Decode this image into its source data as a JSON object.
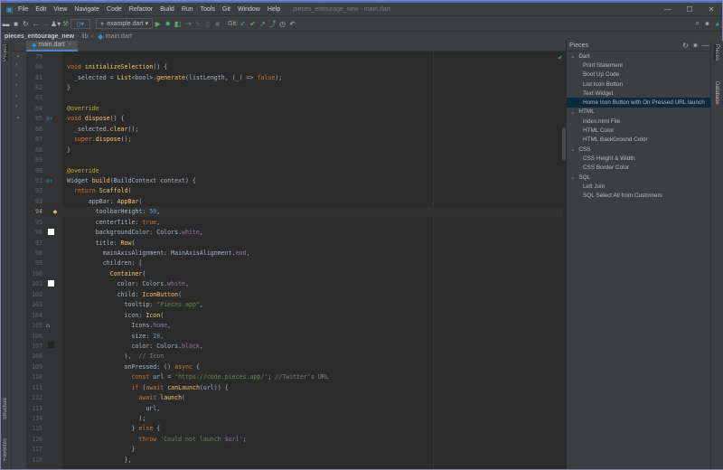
{
  "window": {
    "title": "pieces_entourage_new - main.dart",
    "menu": [
      "File",
      "Edit",
      "View",
      "Navigate",
      "Code",
      "Refactor",
      "Build",
      "Run",
      "Tools",
      "Git",
      "Window",
      "Help"
    ]
  },
  "toolbar": {
    "run_config": "example.dart",
    "git_label": "Git:"
  },
  "breadcrumb": [
    "pieces_entourage_new",
    "lib",
    "main.dart"
  ],
  "tab": {
    "label": "main.dart"
  },
  "side_labels": {
    "project": "Project",
    "structure": "Structure",
    "favorites": "Favorites",
    "pieces": "Pieces",
    "database": "Database"
  },
  "code": [
    {
      "n": "79",
      "t": []
    },
    {
      "n": "80",
      "t": [
        [
          "void ",
          "k"
        ],
        [
          "initializeSelection",
          "f"
        ],
        [
          "() {",
          ""
        ]
      ]
    },
    {
      "n": "81",
      "t": [
        [
          "  _selected = ",
          ""
        ],
        [
          "List",
          "f"
        ],
        [
          "<bool>.",
          ""
        ],
        [
          "generate",
          "f"
        ],
        [
          "(listLength, (_) => ",
          ""
        ],
        [
          "false",
          "k"
        ],
        [
          ");",
          ""
        ]
      ]
    },
    {
      "n": "82",
      "t": [
        [
          "}",
          ""
        ]
      ]
    },
    {
      "n": "83",
      "t": []
    },
    {
      "n": "84",
      "t": [
        [
          "@override",
          "a"
        ]
      ]
    },
    {
      "n": "85",
      "t": [
        [
          "void ",
          "k"
        ],
        [
          "dispose",
          "f"
        ],
        [
          "() {",
          ""
        ]
      ],
      "m": "override"
    },
    {
      "n": "86",
      "t": [
        [
          "  _selected.",
          ""
        ],
        [
          "clear",
          "f"
        ],
        [
          "();",
          ""
        ]
      ]
    },
    {
      "n": "87",
      "t": [
        [
          "  super",
          "k"
        ],
        [
          ".",
          ""
        ],
        [
          "dispose",
          "f"
        ],
        [
          "();",
          ""
        ]
      ]
    },
    {
      "n": "88",
      "t": [
        [
          "}",
          ""
        ]
      ]
    },
    {
      "n": "89",
      "t": []
    },
    {
      "n": "90",
      "t": [
        [
          "@override",
          "a"
        ]
      ]
    },
    {
      "n": "91",
      "t": [
        [
          "Widget ",
          ""
        ],
        [
          "build",
          "f"
        ],
        [
          "(BuildContext context) {",
          ""
        ]
      ],
      "m": "override"
    },
    {
      "n": "92",
      "t": [
        [
          "  return ",
          "k"
        ],
        [
          "Scaffold",
          "f"
        ],
        [
          "(",
          ""
        ]
      ]
    },
    {
      "n": "93",
      "t": [
        [
          "      appBar: ",
          ""
        ],
        [
          "AppBar",
          "f"
        ],
        [
          "(",
          ""
        ]
      ]
    },
    {
      "n": "94",
      "t": [
        [
          "        toolbarHeight: ",
          ""
        ],
        [
          "50",
          "n"
        ],
        [
          ",",
          ""
        ]
      ],
      "cur": true,
      "m": "bulb"
    },
    {
      "n": "95",
      "t": [
        [
          "        centerTitle: ",
          ""
        ],
        [
          "true",
          "k"
        ],
        [
          ",",
          ""
        ]
      ]
    },
    {
      "n": "96",
      "t": [
        [
          "        backgroundColor: Colors.",
          ""
        ],
        [
          "white",
          "p"
        ],
        [
          ",",
          ""
        ]
      ],
      "m": "white"
    },
    {
      "n": "97",
      "t": [
        [
          "        title: ",
          ""
        ],
        [
          "Row",
          "f"
        ],
        [
          "(",
          ""
        ]
      ]
    },
    {
      "n": "98",
      "t": [
        [
          "          mainAxisAlignment: MainAxisAlignment.",
          ""
        ],
        [
          "end",
          "p"
        ],
        [
          ",",
          ""
        ]
      ]
    },
    {
      "n": "99",
      "t": [
        [
          "          children: [",
          ""
        ]
      ]
    },
    {
      "n": "100",
      "t": [
        [
          "            Container",
          "f"
        ],
        [
          "(",
          ""
        ]
      ]
    },
    {
      "n": "101",
      "t": [
        [
          "              color: Colors.",
          ""
        ],
        [
          "white",
          "p"
        ],
        [
          ",",
          ""
        ]
      ],
      "m": "white"
    },
    {
      "n": "102",
      "t": [
        [
          "              child: ",
          ""
        ],
        [
          "IconButton",
          "f"
        ],
        [
          "(",
          ""
        ]
      ]
    },
    {
      "n": "103",
      "t": [
        [
          "                tooltip: ",
          ""
        ],
        [
          "\"Pieces.app\"",
          "s"
        ],
        [
          ",",
          ""
        ]
      ]
    },
    {
      "n": "104",
      "t": [
        [
          "                icon: ",
          ""
        ],
        [
          "Icon",
          "f"
        ],
        [
          "(",
          ""
        ]
      ]
    },
    {
      "n": "105",
      "t": [
        [
          "                  Icons.",
          ""
        ],
        [
          "home",
          "p"
        ],
        [
          ",",
          ""
        ]
      ],
      "m": "home"
    },
    {
      "n": "106",
      "t": [
        [
          "                  size: ",
          ""
        ],
        [
          "28",
          "n"
        ],
        [
          ",",
          ""
        ]
      ]
    },
    {
      "n": "107",
      "t": [
        [
          "                  color: Colors.",
          ""
        ],
        [
          "black",
          "p"
        ],
        [
          ",",
          ""
        ]
      ],
      "m": "black"
    },
    {
      "n": "108",
      "t": [
        [
          "                ),  ",
          ""
        ],
        [
          "// Icon",
          "c"
        ]
      ]
    },
    {
      "n": "109",
      "t": [
        [
          "                onPressed: () ",
          ""
        ],
        [
          "async",
          "k"
        ],
        [
          " {",
          ""
        ]
      ]
    },
    {
      "n": "110",
      "t": [
        [
          "                  const ",
          "k"
        ],
        [
          "url = ",
          ""
        ],
        [
          "'https://code.pieces.app/'",
          "s"
        ],
        [
          "; ",
          ""
        ],
        [
          "//Twitter's URL",
          "c"
        ]
      ]
    },
    {
      "n": "111",
      "t": [
        [
          "                  if ",
          "k"
        ],
        [
          "(",
          ""
        ],
        [
          "await ",
          "k"
        ],
        [
          "canLaunch",
          "f"
        ],
        [
          "(url)) {",
          ""
        ]
      ]
    },
    {
      "n": "112",
      "t": [
        [
          "                    await ",
          "k"
        ],
        [
          "launch",
          "f"
        ],
        [
          "(",
          ""
        ]
      ]
    },
    {
      "n": "113",
      "t": [
        [
          "                      url,",
          ""
        ]
      ]
    },
    {
      "n": "114",
      "t": [
        [
          "                    );",
          ""
        ]
      ]
    },
    {
      "n": "115",
      "t": [
        [
          "                  } ",
          ""
        ],
        [
          "else ",
          "k"
        ],
        [
          "{",
          ""
        ]
      ]
    },
    {
      "n": "116",
      "t": [
        [
          "                    throw ",
          "k"
        ],
        [
          "'Could not launch ",
          "s"
        ],
        [
          "$url",
          "p"
        ],
        [
          "'",
          "s"
        ],
        [
          ";",
          ""
        ]
      ]
    },
    {
      "n": "117",
      "t": [
        [
          "                  }",
          ""
        ]
      ]
    },
    {
      "n": "118",
      "t": [
        [
          "                },",
          ""
        ]
      ]
    }
  ],
  "pieces": {
    "title": "Pieces",
    "groups": [
      {
        "name": "Dart",
        "items": [
          "Print Statement",
          "Boot Up Code",
          "List Icon Button",
          "Text Widget",
          "Home Icon Button with On Pressed URL launch"
        ]
      },
      {
        "name": "HTML",
        "items": [
          "index.html File",
          "HTML Color",
          "HTML BackGround Color"
        ]
      },
      {
        "name": "CSS",
        "items": [
          "CSS Height & Width",
          "CSS Border Color"
        ]
      },
      {
        "name": "SQL",
        "items": [
          "Left Join",
          "SQL Select All from Customers"
        ]
      }
    ],
    "selected": "Home Icon Button with On Pressed URL launch"
  }
}
